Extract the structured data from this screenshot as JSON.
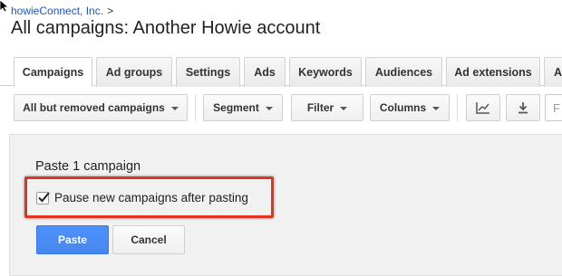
{
  "breadcrumb": {
    "account_link": "howieConnect, Inc.",
    "separator": ">"
  },
  "page_title": "All campaigns: Another Howie account",
  "tabs": [
    {
      "label": "Campaigns"
    },
    {
      "label": "Ad groups"
    },
    {
      "label": "Settings"
    },
    {
      "label": "Ads"
    },
    {
      "label": "Keywords"
    },
    {
      "label": "Audiences"
    },
    {
      "label": "Ad extensions"
    },
    {
      "label": "A"
    }
  ],
  "toolbar": {
    "status_filter": "All but removed campaigns",
    "segment": "Segment",
    "filter": "Filter",
    "columns": "Columns",
    "chart_icon": "line-chart-icon",
    "download_icon": "download-icon",
    "search_partial": "F"
  },
  "paste_panel": {
    "title": "Paste 1 campaign",
    "pause_checkbox_label": "Pause new campaigns after pasting",
    "pause_checked": true,
    "paste_button": "Paste",
    "cancel_button": "Cancel"
  },
  "colors": {
    "link": "#1a55c8",
    "primary_button": "#4d90fe",
    "highlight": "#e5321f",
    "panel_bg": "#f1f1f1"
  }
}
